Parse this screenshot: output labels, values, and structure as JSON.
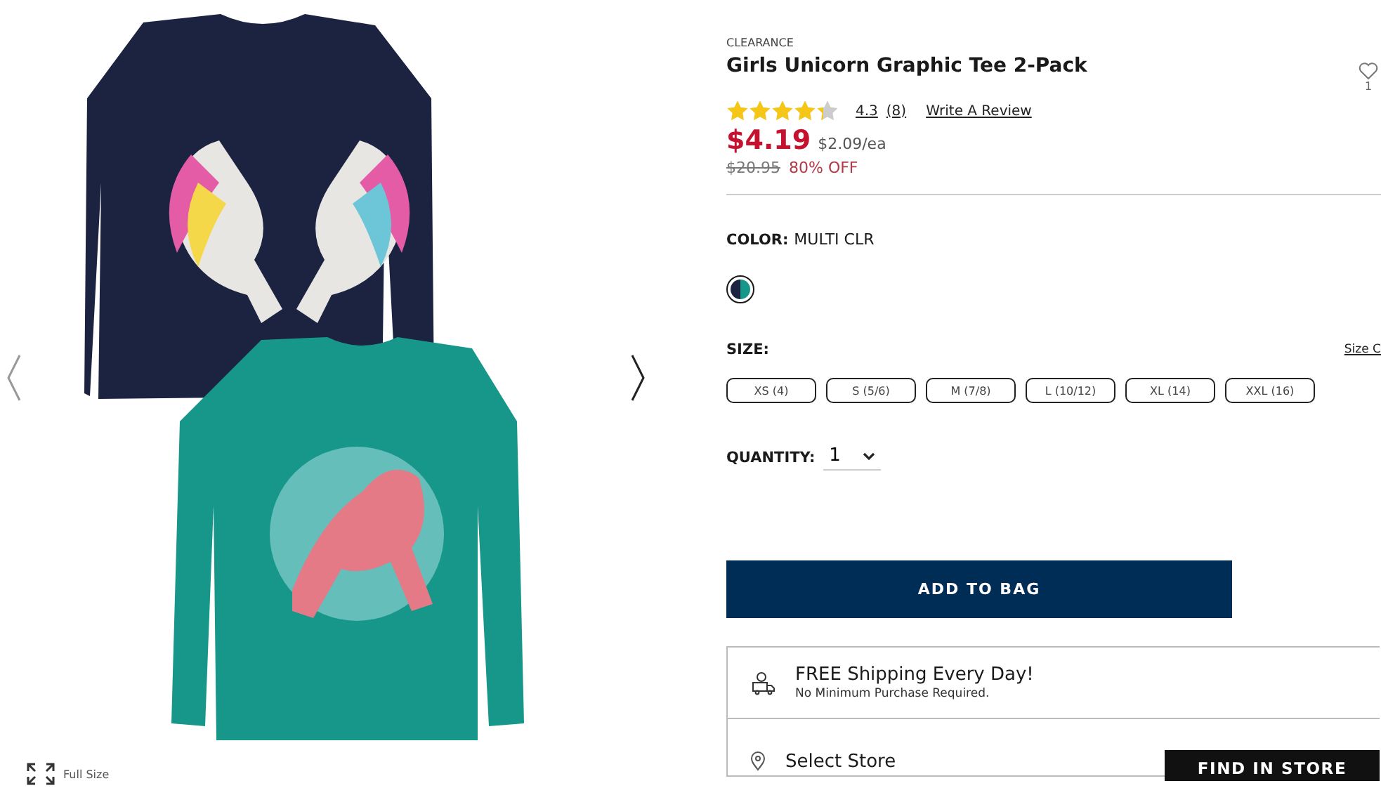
{
  "gallery": {
    "full_size_label": "Full Size"
  },
  "product": {
    "badge": "CLEARANCE",
    "title": "Girls Unicorn Graphic Tee 2-Pack",
    "stars": 4.3,
    "rating": "4.3",
    "review_count": "(8)",
    "write_review": "Write A Review",
    "price": "$4.19",
    "unit_price": "$2.09/ea",
    "original_price": "$20.95",
    "discount": "80% OFF"
  },
  "wishlist": {
    "count": "1"
  },
  "color": {
    "label": "COLOR:",
    "value": "MULTI CLR",
    "swatches": [
      {
        "selected": true
      }
    ]
  },
  "size": {
    "label": "SIZE:",
    "chart_link": "Size C",
    "options": [
      {
        "label": "XS (4)",
        "selected": false
      },
      {
        "label": "S (5/6)",
        "selected": false
      },
      {
        "label": "M (7/8)",
        "selected": false
      },
      {
        "label": "L (10/12)",
        "selected": false
      },
      {
        "label": "XL (14)",
        "selected": false
      },
      {
        "label": "XXL (16)",
        "selected": false
      }
    ]
  },
  "quantity": {
    "label": "QUANTITY:",
    "value": "1"
  },
  "add_to_bag": "ADD TO BAG",
  "shipping": {
    "title": "FREE Shipping Every Day!",
    "note": "No Minimum Purchase Required."
  },
  "store": {
    "label": "Select Store",
    "button": "FIND IN STORE"
  }
}
